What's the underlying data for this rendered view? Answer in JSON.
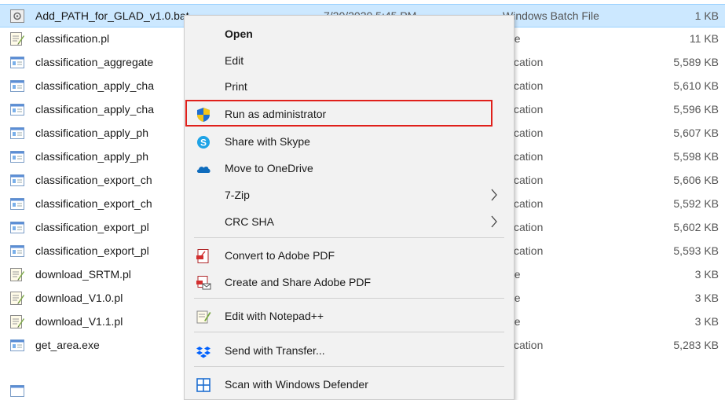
{
  "file_list": {
    "rows": [
      {
        "name": "Add_PATH_for_GLAD_v1.0.bat",
        "date": "7/20/2020 5:45 PM",
        "type": "Windows Batch File",
        "size": "1 KB",
        "icon": "batch-file-icon"
      },
      {
        "name": "classification.pl",
        "date": "",
        "type": "File",
        "size": "11 KB",
        "icon": "perl-script-icon"
      },
      {
        "name": "classification_aggregate",
        "date": "",
        "type": "plication",
        "size": "5,589 KB",
        "icon": "application-icon"
      },
      {
        "name": "classification_apply_cha",
        "date": "",
        "type": "plication",
        "size": "5,610 KB",
        "icon": "application-icon"
      },
      {
        "name": "classification_apply_cha",
        "date": "",
        "type": "plication",
        "size": "5,596 KB",
        "icon": "application-icon"
      },
      {
        "name": "classification_apply_ph",
        "date": "",
        "type": "plication",
        "size": "5,607 KB",
        "icon": "application-icon"
      },
      {
        "name": "classification_apply_ph",
        "date": "",
        "type": "plication",
        "size": "5,598 KB",
        "icon": "application-icon"
      },
      {
        "name": "classification_export_ch",
        "date": "",
        "type": "plication",
        "size": "5,606 KB",
        "icon": "application-icon"
      },
      {
        "name": "classification_export_ch",
        "date": "",
        "type": "plication",
        "size": "5,592 KB",
        "icon": "application-icon"
      },
      {
        "name": "classification_export_pl",
        "date": "",
        "type": "plication",
        "size": "5,602 KB",
        "icon": "application-icon"
      },
      {
        "name": "classification_export_pl",
        "date": "",
        "type": "plication",
        "size": "5,593 KB",
        "icon": "application-icon"
      },
      {
        "name": "download_SRTM.pl",
        "date": "",
        "type": "File",
        "size": "3 KB",
        "icon": "perl-script-icon"
      },
      {
        "name": "download_V1.0.pl",
        "date": "",
        "type": "File",
        "size": "3 KB",
        "icon": "perl-script-icon"
      },
      {
        "name": "download_V1.1.pl",
        "date": "",
        "type": "File",
        "size": "3 KB",
        "icon": "perl-script-icon"
      },
      {
        "name": "get_area.exe",
        "date": "",
        "type": "plication",
        "size": "5,283 KB",
        "icon": "application-icon"
      }
    ]
  },
  "context_menu": {
    "open": "Open",
    "edit": "Edit",
    "print": "Print",
    "run_as_admin": "Run as administrator",
    "share_skype": "Share with Skype",
    "move_onedrive": "Move to OneDrive",
    "seven_zip": "7-Zip",
    "crc_sha": "CRC SHA",
    "convert_pdf": "Convert to Adobe PDF",
    "create_share_pdf": "Create and Share Adobe PDF",
    "edit_notepad": "Edit with Notepad++",
    "send_transfer": "Send with Transfer...",
    "scan_defender": "Scan with Windows Defender"
  },
  "colors": {
    "selection": "#cce8ff",
    "menu_bg": "#f2f2f2",
    "highlight_border": "#e0201b",
    "shield_blue": "#1f6fd1",
    "shield_yellow": "#f5c518"
  }
}
